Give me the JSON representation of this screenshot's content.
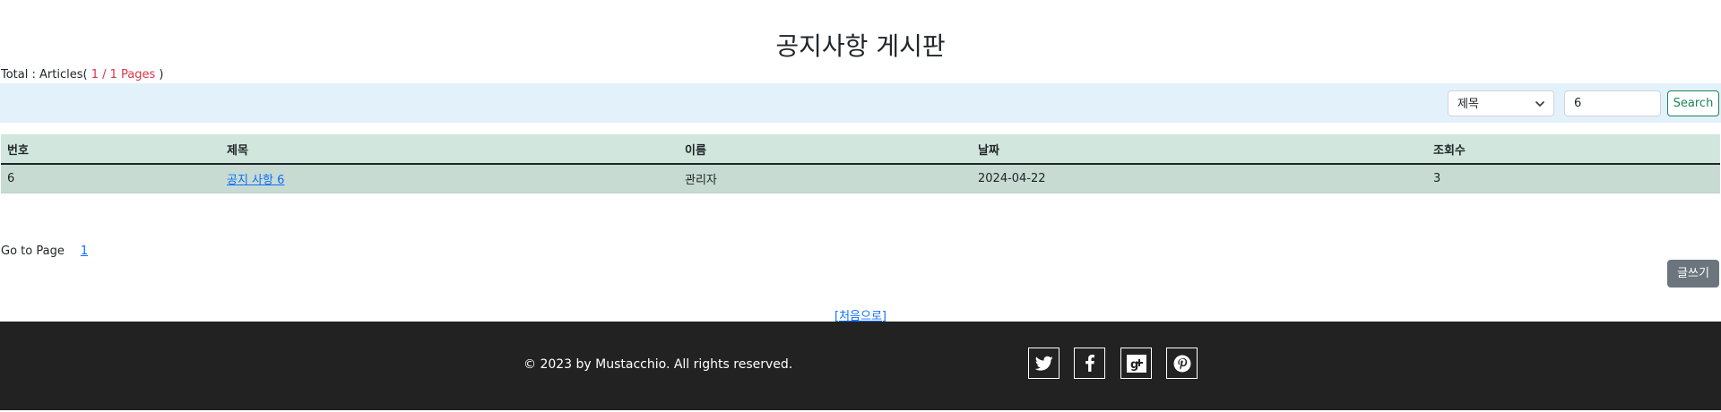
{
  "header": {
    "title": "공지사항 게시판"
  },
  "summary": {
    "prefix": "Total : Articles(",
    "pages": " 1 / 1 Pages ",
    "suffix": ")"
  },
  "search": {
    "field_options": [
      "제목"
    ],
    "selected_field": "제목",
    "query": "6",
    "button_label": "Search"
  },
  "table": {
    "columns": [
      "번호",
      "제목",
      "이름",
      "날짜",
      "조회수"
    ],
    "rows": [
      [
        "6",
        "공지 사항 6",
        "관리자",
        "2024-04-22",
        "3"
      ]
    ]
  },
  "pagination": {
    "label": "Go to Page",
    "pages": [
      "1"
    ]
  },
  "actions": {
    "write_label": "글쓰기",
    "home_label": "[처음으로]"
  },
  "footer": {
    "copyright": "© 2023 by Mustacchio. All rights reserved.",
    "social_icons": [
      "twitter-icon",
      "facebook-icon",
      "google-plus-icon",
      "pinterest-icon"
    ]
  },
  "colors": {
    "search_bar_bg": "#e3f1fb",
    "table_header_bg": "#d1e7dd",
    "table_row_bg": "#c7dbd2",
    "footer_bg": "#222222",
    "accent_red": "#dc3545",
    "link_blue": "#0d6efd",
    "search_button_green": "#198754",
    "write_button_gray": "#6c757d"
  }
}
